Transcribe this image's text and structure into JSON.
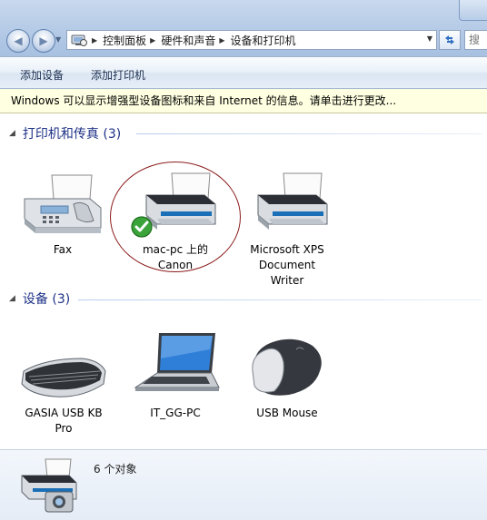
{
  "address": {
    "crumbs": [
      "控制面板",
      "硬件和声音",
      "设备和打印机"
    ],
    "search_placeholder": "搜"
  },
  "commands": {
    "add_device": "添加设备",
    "add_printer": "添加打印机"
  },
  "infobar": {
    "text": "Windows 可以显示增强型设备图标和来自 Internet 的信息。请单击进行更改..."
  },
  "groups": {
    "printers": {
      "title": "打印机和传真 (3)",
      "items": [
        {
          "label_lines": [
            "Fax"
          ],
          "icon": "fax-icon"
        },
        {
          "label_lines": [
            "mac-pc 上的",
            "Canon"
          ],
          "icon": "printer-icon",
          "default": true
        },
        {
          "label_lines": [
            "Microsoft XPS",
            "Document",
            "Writer"
          ],
          "icon": "printer-icon"
        }
      ]
    },
    "devices": {
      "title": "设备 (3)",
      "items": [
        {
          "label_lines": [
            "GASIA USB KB",
            "Pro"
          ],
          "icon": "keyboard-icon"
        },
        {
          "label_lines": [
            "IT_GG-PC"
          ],
          "icon": "laptop-icon"
        },
        {
          "label_lines": [
            "USB Mouse"
          ],
          "icon": "mouse-icon"
        }
      ]
    }
  },
  "details": {
    "count": "6 个对象",
    "icon": "devices-and-printers-icon"
  },
  "colors": {
    "group_header": "#1e3287",
    "infobar_bg": "#ffffe1",
    "highlight_circle": "#8b1c1c"
  }
}
